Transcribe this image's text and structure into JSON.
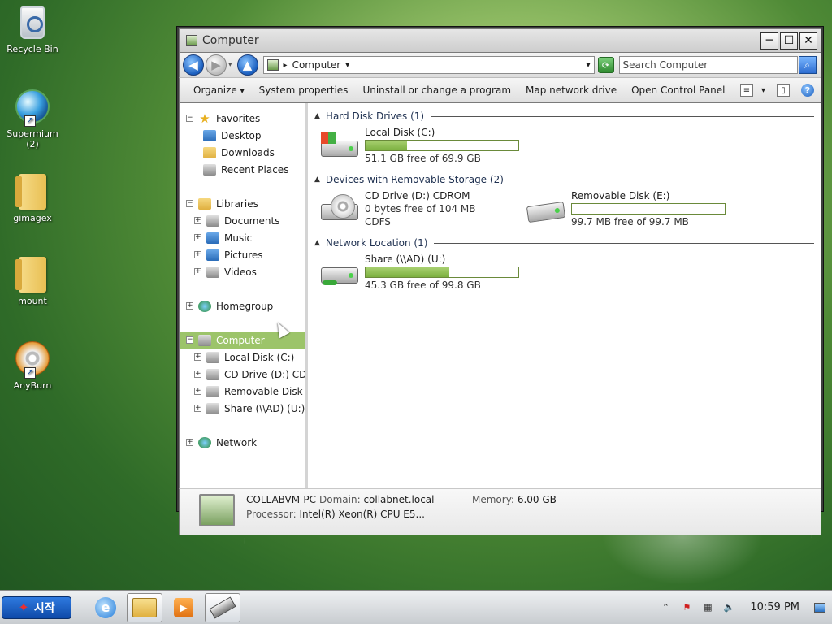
{
  "desktop": {
    "icons": [
      {
        "label": "Recycle Bin",
        "icon": "recycle-bin-icon"
      },
      {
        "label": "Supermium\n(2)",
        "icon": "supermium-browser-icon",
        "shortcut": true
      },
      {
        "label": "gimagex",
        "icon": "folder-icon"
      },
      {
        "label": "mount",
        "icon": "folder-icon"
      },
      {
        "label": "AnyBurn",
        "icon": "cd-burner-icon",
        "shortcut": true
      }
    ]
  },
  "window": {
    "title": "Computer",
    "controls": {
      "minimize": "─",
      "maximize": "☐",
      "close": "✕"
    },
    "address": {
      "crumb_arrow": "▸",
      "location": "Computer",
      "dropdown": "▾"
    },
    "search": {
      "placeholder": "Search Computer"
    },
    "toolbar": {
      "organize": "Organize",
      "organize_arrow": "▾",
      "system_properties": "System properties",
      "uninstall": "Uninstall or change a program",
      "map_drive": "Map network drive",
      "control_panel": "Open Control Panel"
    },
    "navpane": {
      "favorites": "Favorites",
      "desktop": "Desktop",
      "downloads": "Downloads",
      "recent_places": "Recent Places",
      "libraries": "Libraries",
      "documents": "Documents",
      "music": "Music",
      "pictures": "Pictures",
      "videos": "Videos",
      "homegroup": "Homegroup",
      "computer": "Computer",
      "local_disk": "Local Disk (C:)",
      "cd_drive": "CD Drive (D:) CDROM",
      "removable": "Removable Disk (E:)",
      "share": "Share (\\\\AD) (U:)",
      "network": "Network"
    },
    "groups": {
      "hdd": "Hard Disk Drives (1)",
      "removable": "Devices with Removable Storage (2)",
      "network": "Network Location (1)"
    },
    "drives": {
      "c": {
        "name": "Local Disk (C:)",
        "free": "51.1 GB free of 69.9 GB",
        "used_fraction": 0.27
      },
      "d": {
        "name": "CD Drive (D:) CDROM",
        "free": "0 bytes free of 104 MB",
        "fs": "CDFS"
      },
      "e": {
        "name": "Removable Disk (E:)",
        "free": "99.7 MB free of 99.7 MB",
        "used_fraction": 0.0
      },
      "u": {
        "name": "Share (\\\\AD) (U:)",
        "free": "45.3 GB free of 99.8 GB",
        "used_fraction": 0.55
      }
    },
    "details": {
      "computer_name": "COLLABVM-PC",
      "domain_label": "Domain:",
      "domain": "collabnet.local",
      "memory_label": "Memory:",
      "memory": "6.00 GB",
      "processor_label": "Processor:",
      "processor": "Intel(R) Xeon(R) CPU E5..."
    }
  },
  "taskbar": {
    "start_label": "시작",
    "clock": "10:59 PM",
    "tray_expand": "⌃"
  }
}
